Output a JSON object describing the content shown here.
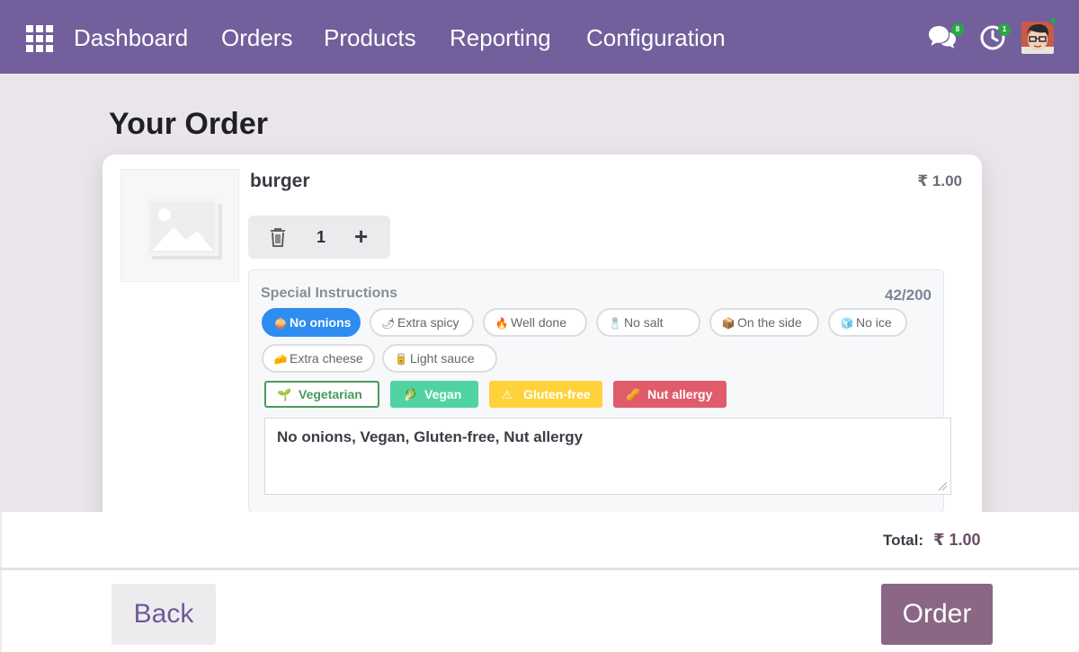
{
  "nav": {
    "items": [
      "Dashboard",
      "Orders",
      "Products",
      "Reporting",
      "Configuration"
    ],
    "chat_badge": "8",
    "activity_badge": "1"
  },
  "page": {
    "title": "Your Order"
  },
  "order_item": {
    "name": "burger",
    "price": "₹ 1.00",
    "quantity": "1"
  },
  "instructions": {
    "label": "Special Instructions",
    "count": "42/200",
    "quick_options": [
      {
        "label": "No onions",
        "icon": "onion-icon",
        "selected": true
      },
      {
        "label": "Extra spicy",
        "icon": "chili-icon",
        "selected": false
      },
      {
        "label": "Well done",
        "icon": "fire-icon",
        "selected": false
      },
      {
        "label": "No salt",
        "icon": "salt-shaker-icon",
        "selected": false
      },
      {
        "label": "On the side",
        "icon": "box-icon",
        "selected": false
      },
      {
        "label": "No ice",
        "icon": "ice-cube-icon",
        "selected": false
      },
      {
        "label": "Extra cheese",
        "icon": "cheese-icon",
        "selected": false
      },
      {
        "label": "Light sauce",
        "icon": "sauce-bottle-icon",
        "selected": false
      }
    ],
    "dietary_tags": [
      {
        "label": "Vegetarian",
        "icon": "sprout-icon",
        "color": "#4a9a5c"
      },
      {
        "label": "Vegan",
        "icon": "leaf-icon",
        "color": "#4fd3a3"
      },
      {
        "label": "Gluten-free",
        "icon": "warning-icon",
        "color": "#ffd23b"
      },
      {
        "label": "Nut allergy",
        "icon": "peanut-icon",
        "color": "#e05c6b"
      }
    ],
    "note_text": "No onions, Vegan, Gluten-free, Nut allergy"
  },
  "footer": {
    "total_label": "Total:",
    "total_value": "₹ 1.00",
    "back_label": "Back",
    "order_label": "Order"
  },
  "colors": {
    "nav_bg": "#725f9c",
    "accent_blue": "#2f8cf0",
    "order_button": "#8a6785"
  }
}
